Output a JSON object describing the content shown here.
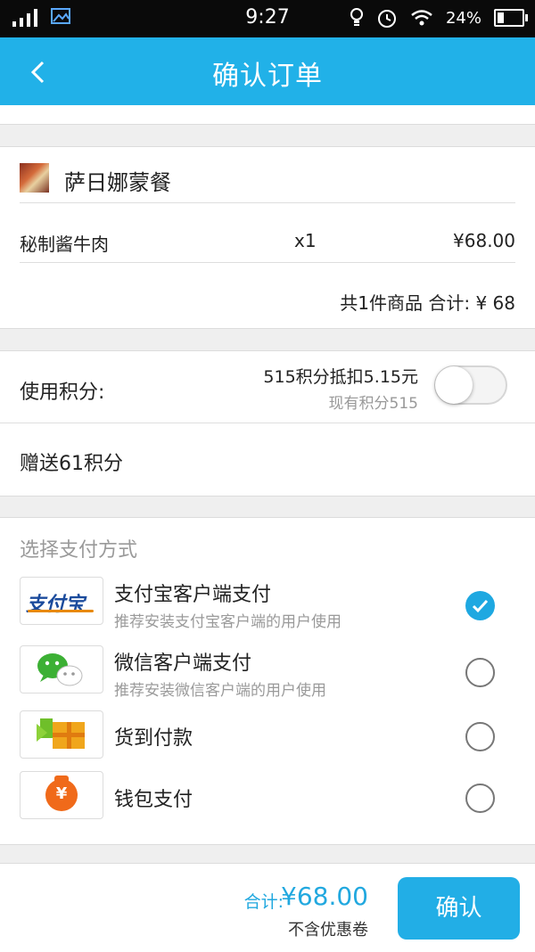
{
  "status_bar": {
    "time": "9:27",
    "battery": "24%"
  },
  "header": {
    "title": "确认订单"
  },
  "order": {
    "shop_name": "萨日娜蒙餐",
    "item_name": "秘制酱牛肉",
    "item_qty": "x1",
    "item_price": "¥68.00",
    "summary": "共1件商品  合计: ¥ 68"
  },
  "points": {
    "label": "使用积分:",
    "deduct_text": "515积分抵扣5.15元",
    "current_text": "现有积分515",
    "toggle_on": false,
    "gift_text": "赠送61积分"
  },
  "payment": {
    "section_title": "选择支付方式",
    "options": [
      {
        "name": "支付宝客户端支付",
        "desc": "推荐安装支付宝客户端的用户使用",
        "icon": "alipay-icon",
        "logo_text": "支付宝",
        "selected": true
      },
      {
        "name": "微信客户端支付",
        "desc": "推荐安装微信客户端的用户使用",
        "icon": "wechat-icon",
        "selected": false
      },
      {
        "name": "货到付款",
        "desc": "",
        "icon": "cash-on-delivery-icon",
        "selected": false
      },
      {
        "name": "钱包支付",
        "desc": "",
        "icon": "wallet-icon",
        "logo_text": "¥",
        "selected": false
      }
    ]
  },
  "footer": {
    "total_label": "合计:",
    "total_amount": "¥68.00",
    "note": "不含优惠卷",
    "confirm_label": "确认"
  },
  "colors": {
    "accent": "#21b1e8",
    "status_bar": "#0a0a0a",
    "background": "#efefef"
  }
}
